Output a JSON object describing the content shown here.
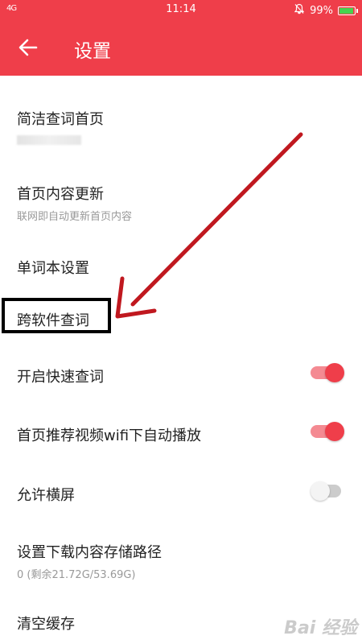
{
  "status_bar": {
    "signal": "4G",
    "time": "11:14",
    "battery": "99%",
    "battery_level": 0.99,
    "battery_color": "#45d34f"
  },
  "header": {
    "title": "设置",
    "back_icon": "arrow-left-icon",
    "color": "#ef3e4a"
  },
  "settings": {
    "simple_home": {
      "label": "简洁查词首页"
    },
    "home_update": {
      "label": "首页内容更新",
      "sub": "联网即自动更新首页内容"
    },
    "wordbook": {
      "label": "单词本设置"
    },
    "cross_app": {
      "label": "跨软件查词"
    },
    "quick_lookup": {
      "label": "开启快速查词",
      "enabled": true
    },
    "autoplay_video": {
      "label": "首页推荐视频wifi下自动播放",
      "enabled": true
    },
    "landscape": {
      "label": "允许横屏",
      "enabled": false
    },
    "download_path": {
      "label": "设置下载内容存储路径",
      "sub": "0 (剩余21.72G/53.69G)"
    },
    "clear_cache": {
      "label": "清空缓存"
    }
  },
  "watermark": {
    "text": "Bai 经验"
  },
  "colors": {
    "accent": "#ef3e4a",
    "annotation_arrow": "#c0181f",
    "annotation_box": "#000000"
  }
}
